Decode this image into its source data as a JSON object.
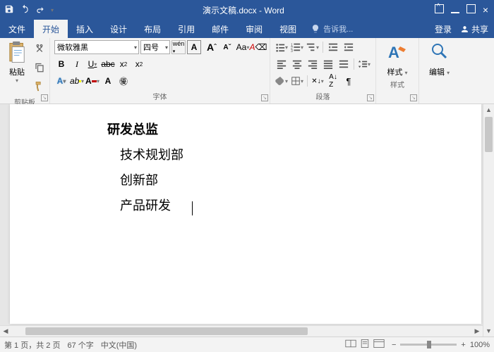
{
  "title": "演示文稿.docx - Word",
  "tabs": {
    "file": "文件",
    "home": "开始",
    "insert": "插入",
    "design": "设计",
    "layout": "布局",
    "references": "引用",
    "mailings": "邮件",
    "review": "审阅",
    "view": "视图"
  },
  "tellme": "告诉我...",
  "login": "登录",
  "share": "共享",
  "groups": {
    "clipboard": "剪贴板",
    "font": "字体",
    "paragraph": "段落",
    "styles": "样式",
    "editing": "编辑"
  },
  "clipboard": {
    "paste": "粘贴"
  },
  "font": {
    "name": "微软雅黑",
    "size": "四号"
  },
  "styles": {
    "label": "样式"
  },
  "editing": {
    "label": "编辑"
  },
  "doc": {
    "heading": "研发总监",
    "line1": "技术规划部",
    "line2": "创新部",
    "line3": "产品研发"
  },
  "status": {
    "page": "第 1 页，共 2 页",
    "words": "67 个字",
    "lang": "中文(中国)",
    "zoom": "100%"
  }
}
